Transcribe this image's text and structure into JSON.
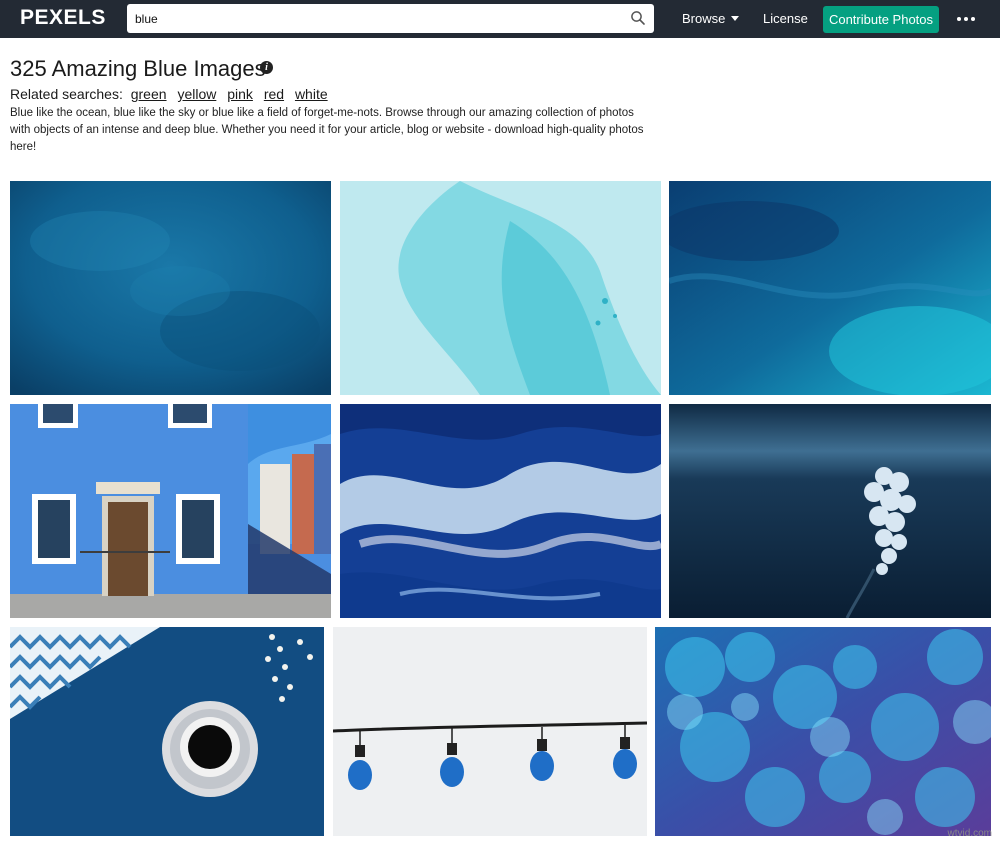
{
  "header": {
    "logo": "PEXELS",
    "search": {
      "value": "blue",
      "icon": "search-icon"
    },
    "nav": {
      "browse_label": "Browse",
      "license_label": "License",
      "contribute_label": "Contribute Photos"
    },
    "more_icon": "ellipsis-icon",
    "colors": {
      "bar": "#232a34",
      "contribute": "#05a081"
    }
  },
  "page": {
    "title": "325 Amazing Blue Images",
    "info_icon": "info-icon",
    "related_label": "Related searches:",
    "related": [
      "green",
      "yellow",
      "pink",
      "red",
      "white"
    ],
    "description": "Blue like the ocean, blue like the sky or blue like a field of forget-me-nots. Browse through our amazing collection of photos with objects of an intense and deep blue. Whether you need it for your article, blog or website - download high-quality photos here!"
  },
  "watermark": "wtvid.com"
}
